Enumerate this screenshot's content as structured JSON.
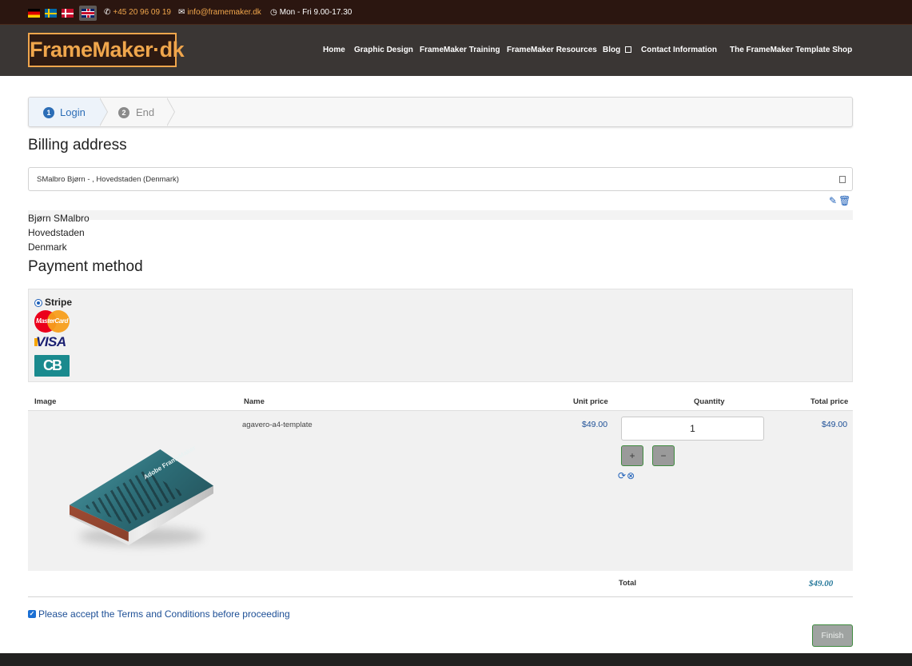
{
  "topbar": {
    "phone": "+45 20 96 09 19",
    "email": "info@framemaker.dk",
    "hours": "Mon - Fri 9.00-17.30",
    "accent_color": "#f0a64c"
  },
  "header": {
    "logo_text": "FrameMaker·dk",
    "nav": [
      {
        "label": "Home"
      },
      {
        "label": "Graphic Design"
      },
      {
        "label": "FrameMaker Training"
      },
      {
        "label": "FrameMaker Resources"
      },
      {
        "label": "Blog"
      },
      {
        "label": "Contact Information"
      },
      {
        "label": "The FrameMaker Template Shop"
      }
    ]
  },
  "wizard": {
    "steps": [
      {
        "number": "1",
        "label": "Login"
      },
      {
        "number": "2",
        "label": "End"
      }
    ]
  },
  "billing": {
    "title": "Billing address",
    "selected_address": "SMalbro Bjørn - , Hovedstaden (Denmark)",
    "name": "Bjørn SMalbro",
    "region": "Hovedstaden",
    "country": "Denmark"
  },
  "payment": {
    "title": "Payment method",
    "method": "Stripe",
    "card_logos": {
      "mastercard": "MasterCard",
      "visa": "VISA",
      "cb": "CB"
    }
  },
  "cart": {
    "headers": {
      "image": "Image",
      "name": "Name",
      "unit_price": "Unit price",
      "quantity": "Quantity",
      "total_price": "Total price"
    },
    "items": [
      {
        "name": "agavero-a4-template",
        "unit_price": "$49.00",
        "quantity": "1",
        "total_price": "$49.00",
        "cover_title": "Adobe FrameMaker",
        "plus": "+",
        "minus": "−"
      }
    ],
    "total_label": "Total",
    "total_value": "$49.00"
  },
  "terms": {
    "label": "Please accept the Terms and Conditions before proceeding",
    "checked": true
  },
  "finish_label": "Finish"
}
